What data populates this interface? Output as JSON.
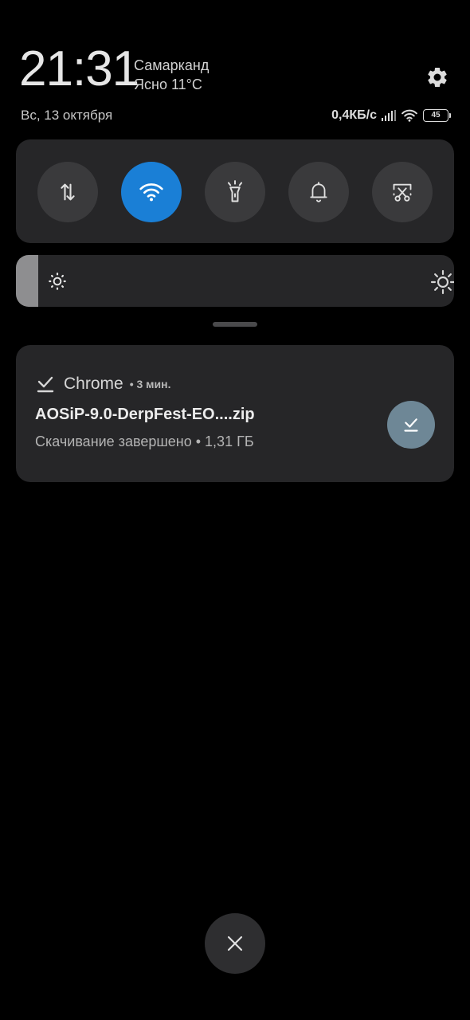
{
  "status": {
    "time": "21:31",
    "city": "Самарканд",
    "weather": "Ясно 11°C",
    "date": "Вс, 13 октября",
    "network_speed": "0,4КБ/с",
    "battery_level": "45"
  },
  "quick_settings": {
    "tiles": [
      {
        "id": "mobile-data",
        "icon": "data-transfer-icon",
        "active": false
      },
      {
        "id": "wifi",
        "icon": "wifi-icon",
        "active": true
      },
      {
        "id": "flashlight",
        "icon": "flashlight-icon",
        "active": false
      },
      {
        "id": "sound",
        "icon": "bell-icon",
        "active": false
      },
      {
        "id": "screenshot",
        "icon": "scissors-screenshot-icon",
        "active": false
      }
    ],
    "brightness_level": 0.05
  },
  "notification": {
    "app_name": "Chrome",
    "time": "• 3 мин.",
    "title": "AOSiP-9.0-DerpFest-EO....zip",
    "text": "Скачивание завершено • 1,31 ГБ",
    "app_icon": "download-done-icon",
    "action_icon": "download-done-icon"
  },
  "colors": {
    "background": "#000000",
    "panel": "#262628",
    "tile_inactive": "#3a3a3c",
    "tile_active": "#1a7fd6",
    "notif_action": "#6e8796"
  }
}
